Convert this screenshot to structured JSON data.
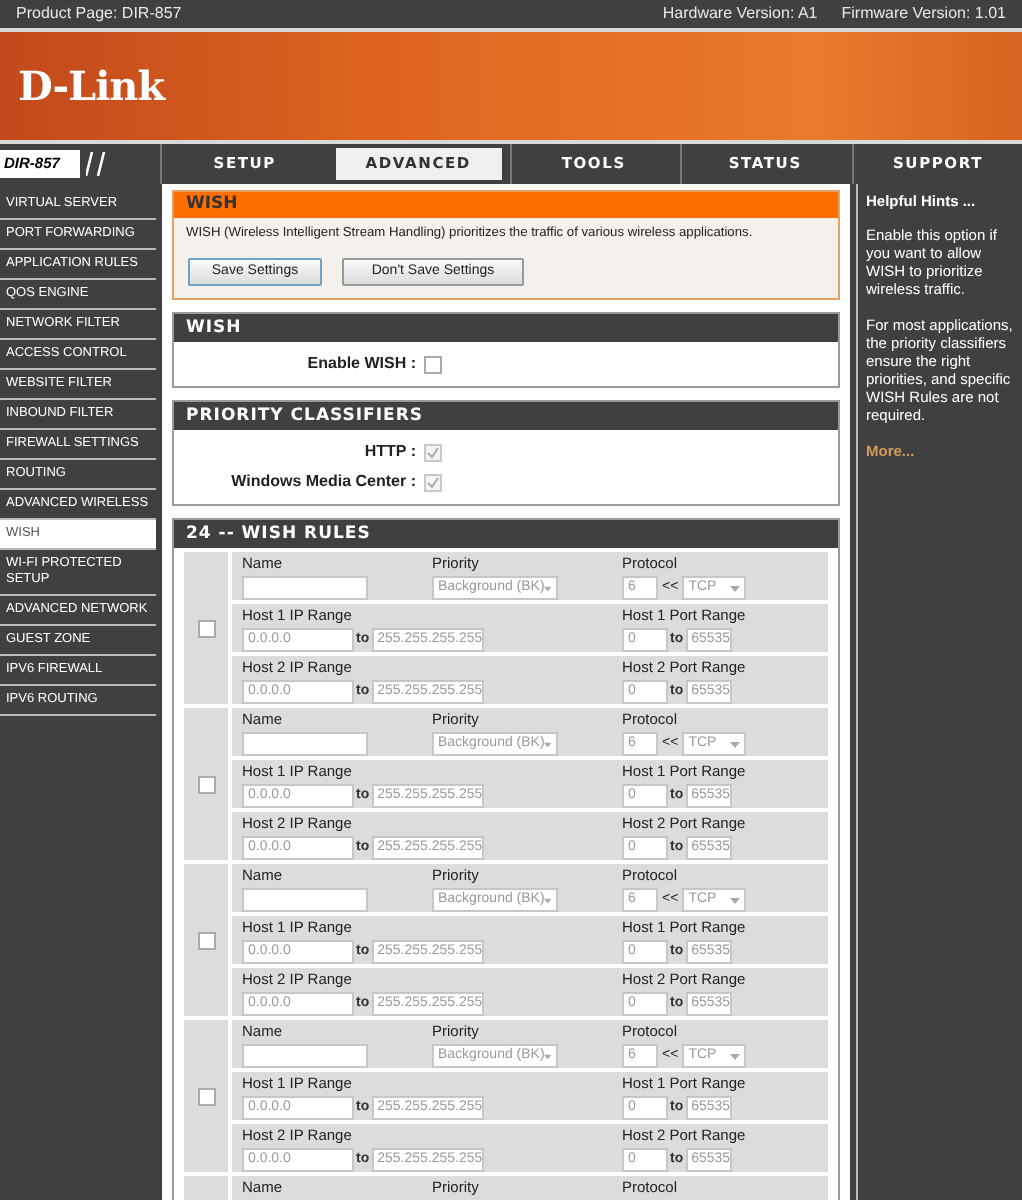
{
  "top_bar": {
    "product": "Product Page: DIR-857",
    "hardware": "Hardware Version: A1",
    "firmware": "Firmware Version: 1.01"
  },
  "logo": "D-Link",
  "model": "DIR-857",
  "tabs": [
    {
      "label": "SETUP",
      "selected": false
    },
    {
      "label": "ADVANCED",
      "selected": true
    },
    {
      "label": "TOOLS",
      "selected": false
    },
    {
      "label": "STATUS",
      "selected": false
    },
    {
      "label": "SUPPORT",
      "selected": false
    }
  ],
  "sidebar": {
    "items": [
      {
        "label": "VIRTUAL SERVER",
        "selected": false
      },
      {
        "label": "PORT FORWARDING",
        "selected": false
      },
      {
        "label": "APPLICATION RULES",
        "selected": false
      },
      {
        "label": "QOS ENGINE",
        "selected": false
      },
      {
        "label": "NETWORK FILTER",
        "selected": false
      },
      {
        "label": "ACCESS CONTROL",
        "selected": false
      },
      {
        "label": "WEBSITE FILTER",
        "selected": false
      },
      {
        "label": "INBOUND FILTER",
        "selected": false
      },
      {
        "label": "FIREWALL SETTINGS",
        "selected": false
      },
      {
        "label": "ROUTING",
        "selected": false
      },
      {
        "label": "ADVANCED WIRELESS",
        "selected": false
      },
      {
        "label": "WISH",
        "selected": true
      },
      {
        "label": "WI-FI PROTECTED SETUP",
        "selected": false
      },
      {
        "label": "ADVANCED NETWORK",
        "selected": false
      },
      {
        "label": "GUEST ZONE",
        "selected": false
      },
      {
        "label": "IPV6 FIREWALL",
        "selected": false
      },
      {
        "label": "IPV6 ROUTING",
        "selected": false
      }
    ]
  },
  "intro": {
    "title": "WISH",
    "description": "WISH (Wireless Intelligent Stream Handling) prioritizes the traffic of various wireless applications.",
    "buttons": [
      "Save Settings",
      "Don't Save Settings"
    ]
  },
  "wish_section": {
    "title": "WISH",
    "fields": [
      {
        "label": "Enable WISH :",
        "checked": false,
        "disabled": false
      }
    ]
  },
  "classifiers_section": {
    "title": "PRIORITY CLASSIFIERS",
    "fields": [
      {
        "label": "HTTP :",
        "checked": true,
        "disabled": true
      },
      {
        "label": "Windows Media Center :",
        "checked": true,
        "disabled": true
      }
    ]
  },
  "rules_section": {
    "title": "24 -- WISH RULES",
    "rules": [
      {
        "checked": false,
        "disabled": true,
        "name": {
          "label": "Name"
        },
        "priority": {
          "label": "Priority",
          "value": "Background (BK)"
        },
        "protocol": {
          "label": "Protocol",
          "number": "6",
          "arrow": "<<",
          "value": "TCP"
        },
        "ranges": [
          {
            "kind": "ip",
            "label": "Host 1 IP Range",
            "from": "0.0.0.0",
            "sep": "to",
            "to": "255.255.255.255"
          },
          {
            "kind": "port",
            "label": "Host 1 Port Range",
            "from": "0",
            "sep": "to",
            "to": "65535"
          },
          {
            "kind": "ip",
            "label": "Host 2 IP Range",
            "from": "0.0.0.0",
            "sep": "to",
            "to": "255.255.255.255"
          },
          {
            "kind": "port",
            "label": "Host 2 Port Range",
            "from": "0",
            "sep": "to",
            "to": "65535"
          }
        ]
      },
      {
        "checked": false,
        "disabled": true,
        "name": {
          "label": "Name"
        },
        "priority": {
          "label": "Priority",
          "value": "Background (BK)"
        },
        "protocol": {
          "label": "Protocol",
          "number": "6",
          "arrow": "<<",
          "value": "TCP"
        },
        "ranges": [
          {
            "kind": "ip",
            "label": "Host 1 IP Range",
            "from": "0.0.0.0",
            "sep": "to",
            "to": "255.255.255.255"
          },
          {
            "kind": "port",
            "label": "Host 1 Port Range",
            "from": "0",
            "sep": "to",
            "to": "65535"
          },
          {
            "kind": "ip",
            "label": "Host 2 IP Range",
            "from": "0.0.0.0",
            "sep": "to",
            "to": "255.255.255.255"
          },
          {
            "kind": "port",
            "label": "Host 2 Port Range",
            "from": "0",
            "sep": "to",
            "to": "65535"
          }
        ]
      },
      {
        "checked": false,
        "disabled": true,
        "name": {
          "label": "Name"
        },
        "priority": {
          "label": "Priority",
          "value": "Background (BK)"
        },
        "protocol": {
          "label": "Protocol",
          "number": "6",
          "arrow": "<<",
          "value": "TCP"
        },
        "ranges": [
          {
            "kind": "ip",
            "label": "Host 1 IP Range",
            "from": "0.0.0.0",
            "sep": "to",
            "to": "255.255.255.255"
          },
          {
            "kind": "port",
            "label": "Host 1 Port Range",
            "from": "0",
            "sep": "to",
            "to": "65535"
          },
          {
            "kind": "ip",
            "label": "Host 2 IP Range",
            "from": "0.0.0.0",
            "sep": "to",
            "to": "255.255.255.255"
          },
          {
            "kind": "port",
            "label": "Host 2 Port Range",
            "from": "0",
            "sep": "to",
            "to": "65535"
          }
        ]
      },
      {
        "checked": false,
        "disabled": true,
        "name": {
          "label": "Name"
        },
        "priority": {
          "label": "Priority",
          "value": "Background (BK)"
        },
        "protocol": {
          "label": "Protocol",
          "number": "6",
          "arrow": "<<",
          "value": "TCP"
        },
        "ranges": [
          {
            "kind": "ip",
            "label": "Host 1 IP Range",
            "from": "0.0.0.0",
            "sep": "to",
            "to": "255.255.255.255"
          },
          {
            "kind": "port",
            "label": "Host 1 Port Range",
            "from": "0",
            "sep": "to",
            "to": "65535"
          },
          {
            "kind": "ip",
            "label": "Host 2 IP Range",
            "from": "0.0.0.0",
            "sep": "to",
            "to": "255.255.255.255"
          },
          {
            "kind": "port",
            "label": "Host 2 Port Range",
            "from": "0",
            "sep": "to",
            "to": "65535"
          }
        ]
      },
      {
        "name": {
          "label": "Name"
        },
        "priority": {
          "label": "Priority"
        },
        "protocol": {
          "label": "Protocol"
        }
      }
    ]
  },
  "hints": {
    "title": "Helpful Hints ...",
    "paragraphs": [
      "Enable this option if you want to allow WISH to prioritize wireless traffic.",
      "For most applications, the priority classifiers ensure the right priorities, and specific WISH Rules are not required."
    ],
    "more": "More..."
  }
}
